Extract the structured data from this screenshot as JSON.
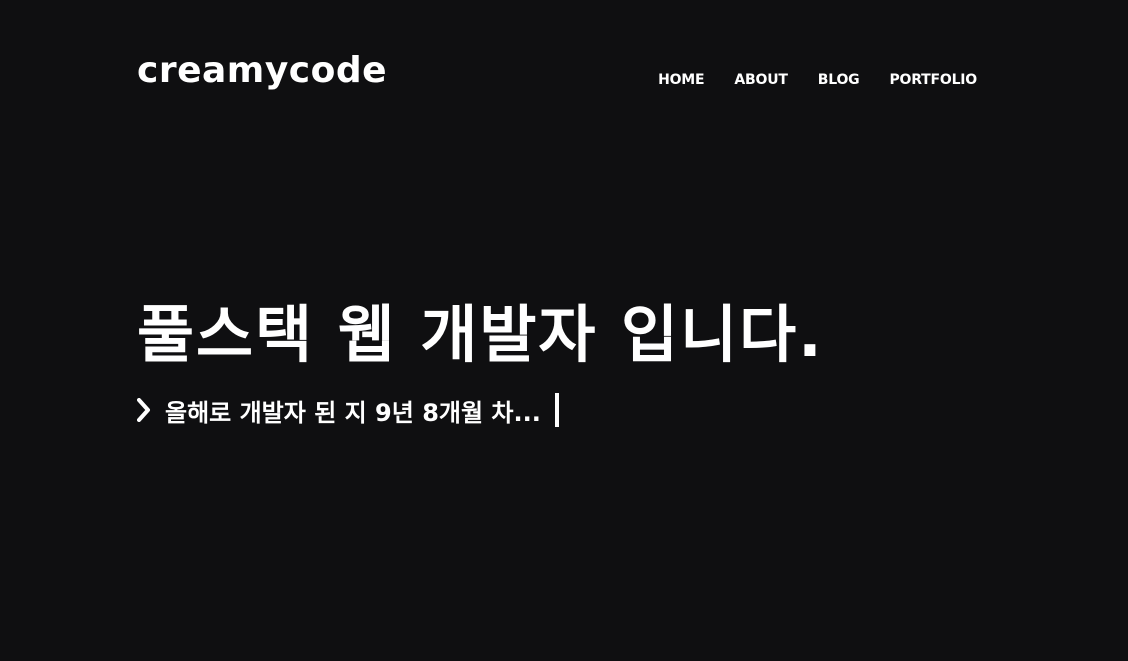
{
  "header": {
    "logo": "creamycode",
    "nav": [
      "HOME",
      "ABOUT",
      "BLOG",
      "PORTFOLIO"
    ]
  },
  "hero": {
    "title": "풀스택 웹 개발자 입니다.",
    "prompt_icon": "chevron-right-icon",
    "typing_text": "올해로 개발자 된 지 9년 8개월 차..."
  },
  "colors": {
    "background": "#0f0f11",
    "text": "#ffffff"
  }
}
